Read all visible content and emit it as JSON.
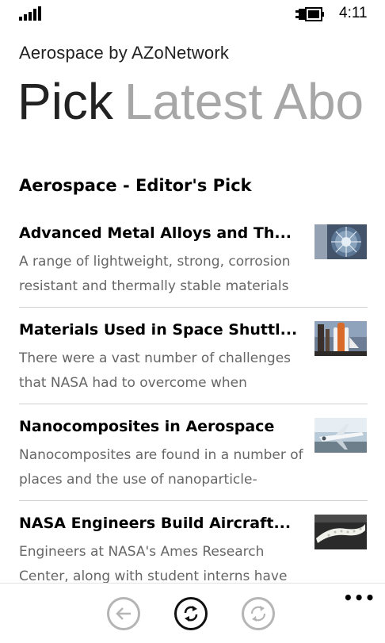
{
  "status": {
    "time": "4:11"
  },
  "app": {
    "title": "Aerospace by AZoNetwork"
  },
  "pivot": {
    "items": [
      "Pick",
      "Latest",
      "Abo"
    ]
  },
  "section": {
    "title": "Aerospace - Editor's Pick"
  },
  "articles": [
    {
      "title": "Advanced Metal Alloys and Th...",
      "snippet": "A range of lightweight, strong, corrosion resistant and thermally stable materials"
    },
    {
      "title": "Materials Used in Space Shuttl...",
      "snippet": "There were a vast number of challenges that NASA had to overcome when"
    },
    {
      "title": "Nanocomposites in Aerospace",
      "snippet": "Nanocomposites are found in a number of places and the use of nanoparticle-"
    },
    {
      "title": "NASA Engineers Build Aircraft...",
      "snippet": "Engineers at NASA's Ames Research Center, along with student interns have"
    }
  ],
  "appbar": {
    "more": "•••"
  },
  "icons": {
    "signal": "signal-strength-icon",
    "battery": "battery-charging-icon",
    "back": "back-arrow-icon",
    "refresh": "refresh-icon",
    "sync": "sync-icon"
  }
}
